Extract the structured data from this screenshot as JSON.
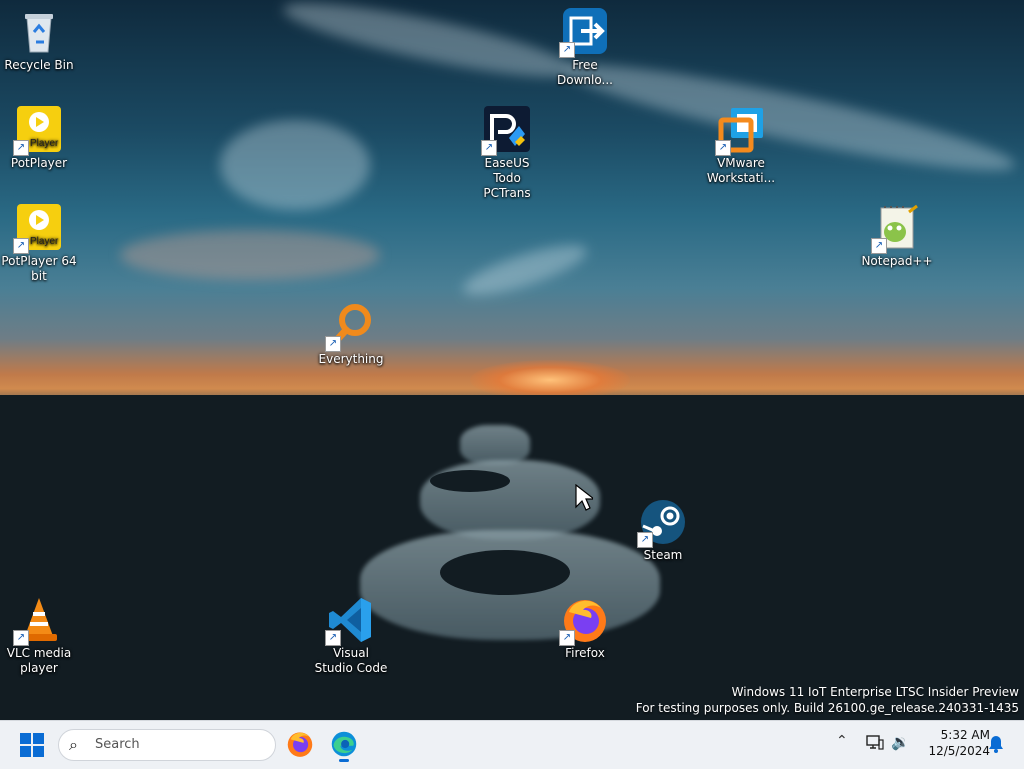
{
  "desktop_icons": [
    {
      "label": "Recycle Bin",
      "icon": "recycle-bin-icon"
    },
    {
      "label": "PotPlayer",
      "icon": "potplayer-icon",
      "badge": "Player"
    },
    {
      "label": "PotPlayer 64 bit",
      "icon": "potplayer-64-icon",
      "badge": "Player"
    },
    {
      "label": "Everything",
      "icon": "everything-search-icon"
    },
    {
      "label": "Free Downlo...",
      "icon": "free-download-manager-icon"
    },
    {
      "label": "EaseUS Todo PCTrans",
      "icon": "easeus-todo-pctrans-icon"
    },
    {
      "label": "VMware Workstati...",
      "icon": "vmware-workstation-icon"
    },
    {
      "label": "Notepad++",
      "icon": "notepad-plus-plus-icon"
    },
    {
      "label": "Steam",
      "icon": "steam-icon"
    },
    {
      "label": "VLC media player",
      "icon": "vlc-icon"
    },
    {
      "label": "Visual Studio Code",
      "icon": "vscode-icon"
    },
    {
      "label": "Firefox",
      "icon": "firefox-icon"
    }
  ],
  "shortcut_glyph": "↗",
  "watermark": {
    "line1": "Windows 11 IoT Enterprise LTSC Insider Preview",
    "line2": "For testing purposes only. Build 26100.ge_release.240331-1435"
  },
  "taskbar": {
    "search_placeholder": "Search",
    "pinned": [
      {
        "name": "Firefox",
        "icon": "firefox-icon"
      },
      {
        "name": "Microsoft Edge",
        "icon": "edge-icon"
      }
    ],
    "tray": {
      "time": "5:32 AM",
      "date": "12/5/2024"
    }
  },
  "colors": {
    "accent": "#0a6cd4",
    "taskbar_bg": "#eef1f5"
  }
}
